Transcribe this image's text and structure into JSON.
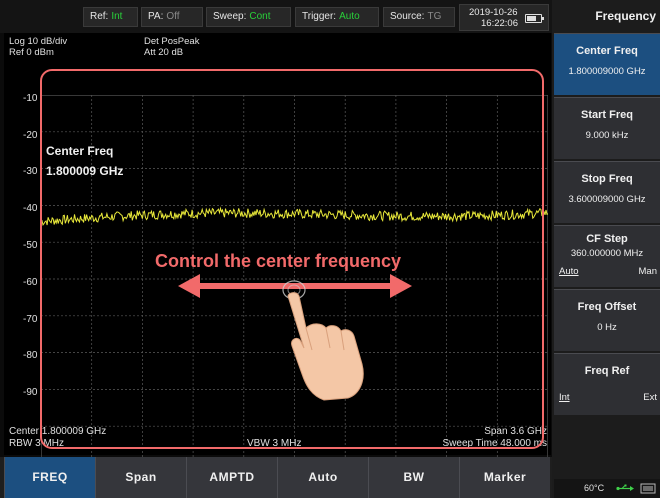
{
  "status_bar": {
    "ref": {
      "label": "Ref:",
      "value": "Int"
    },
    "pa": {
      "label": "PA:",
      "value": "Off"
    },
    "sweep": {
      "label": "Sweep:",
      "value": "Cont"
    },
    "trigger": {
      "label": "Trigger:",
      "value": "Auto"
    },
    "source": {
      "label": "Source:",
      "value": "TG"
    },
    "date": "2019-10-26",
    "time": "16:22:06",
    "battery_icon": "battery-icon"
  },
  "graph": {
    "scale_label": "Log 10 dB/div",
    "ref_label": "Ref 0 dBm",
    "det_label": "Det PosPeak",
    "att_label": "Att 20 dB",
    "y_ticks": [
      "-10",
      "-20",
      "-30",
      "-40",
      "-50",
      "-60",
      "-70",
      "-80",
      "-90"
    ],
    "center_label": "Center 1.800009 GHz",
    "rbw_label": "RBW 3 MHz",
    "vbw_label": "VBW 3 MHz",
    "span_label": "Span 3.6 GHz",
    "sweep_time_label": "Sweep Time 48.000 ms",
    "cf_overlay_title": "Center Freq",
    "cf_overlay_value": "1.800009 GHz",
    "trace_color": "#e8e83a",
    "grid_color": "#5a5a5a"
  },
  "annotation": {
    "text": "Control the center frequency",
    "color": "#f26a6a",
    "hand_icon": "pointing-hand-icon",
    "arrow_icon": "double-arrow-icon"
  },
  "right_panel": {
    "title": "Frequency",
    "softkeys": [
      {
        "title": "Center Freq",
        "value": "1.800009000 GHz",
        "active": true
      },
      {
        "title": "Start Freq",
        "value": "9.000 kHz"
      },
      {
        "title": "Stop Freq",
        "value": "3.600009000 GHz"
      },
      {
        "title": "CF Step",
        "value": "360.000000 MHz",
        "left": "Auto",
        "right": "Man"
      },
      {
        "title": "Freq Offset",
        "value": "0 Hz"
      },
      {
        "title": "Freq Ref",
        "left": "Int",
        "right": "Ext"
      }
    ],
    "temperature": "60°C",
    "usb_icon": "usb-icon",
    "network_icon": "network-icon"
  },
  "bottom_menu": [
    "FREQ",
    "Span",
    "AMPTD",
    "Auto",
    "BW",
    "Marker"
  ],
  "colors": {
    "accent_blue": "#1c4f80",
    "status_value_green": "#29d13a",
    "status_value_off": "#8a8a8a"
  }
}
